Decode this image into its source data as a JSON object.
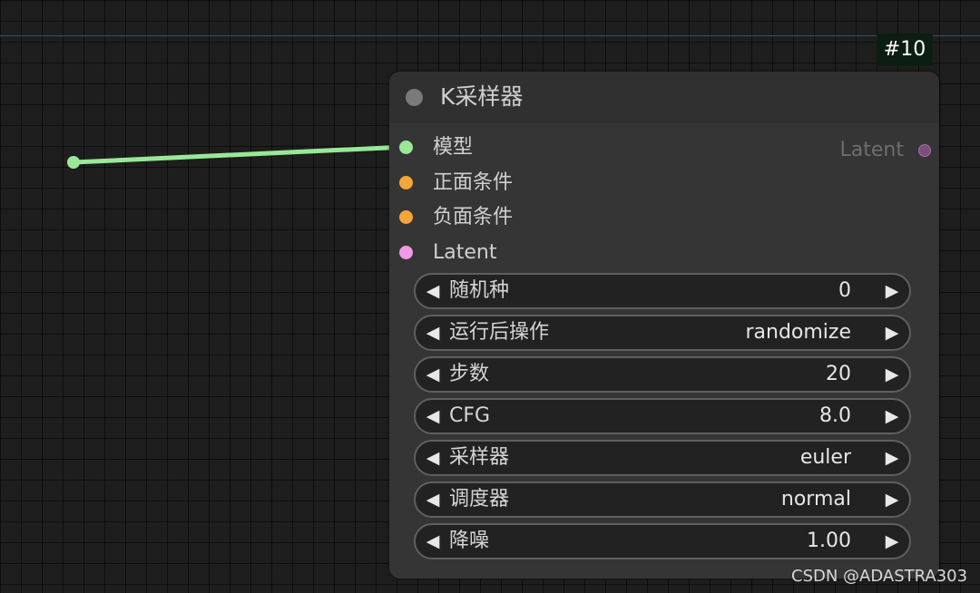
{
  "canvas": {
    "node_id_badge": "#10"
  },
  "node": {
    "title": "K采样器",
    "inputs": [
      {
        "label": "模型",
        "color": "#98e898"
      },
      {
        "label": "正面条件",
        "color": "#f5a53a"
      },
      {
        "label": "负面条件",
        "color": "#f5a53a"
      },
      {
        "label": "Latent",
        "color": "#f09ae6"
      }
    ],
    "outputs": [
      {
        "label": "Latent",
        "color": "#7c4e7c"
      }
    ],
    "widgets": [
      {
        "name": "随机种",
        "value": "0"
      },
      {
        "name": "运行后操作",
        "value": "randomize"
      },
      {
        "name": "步数",
        "value": "20"
      },
      {
        "name": "CFG",
        "value": "8.0"
      },
      {
        "name": "采样器",
        "value": "euler"
      },
      {
        "name": "调度器",
        "value": "normal"
      },
      {
        "name": "降噪",
        "value": "1.00"
      }
    ],
    "arrow_left": "◀",
    "arrow_right": "▶"
  },
  "link_color": "#98e898",
  "watermark": "CSDN @ADASTRA303"
}
